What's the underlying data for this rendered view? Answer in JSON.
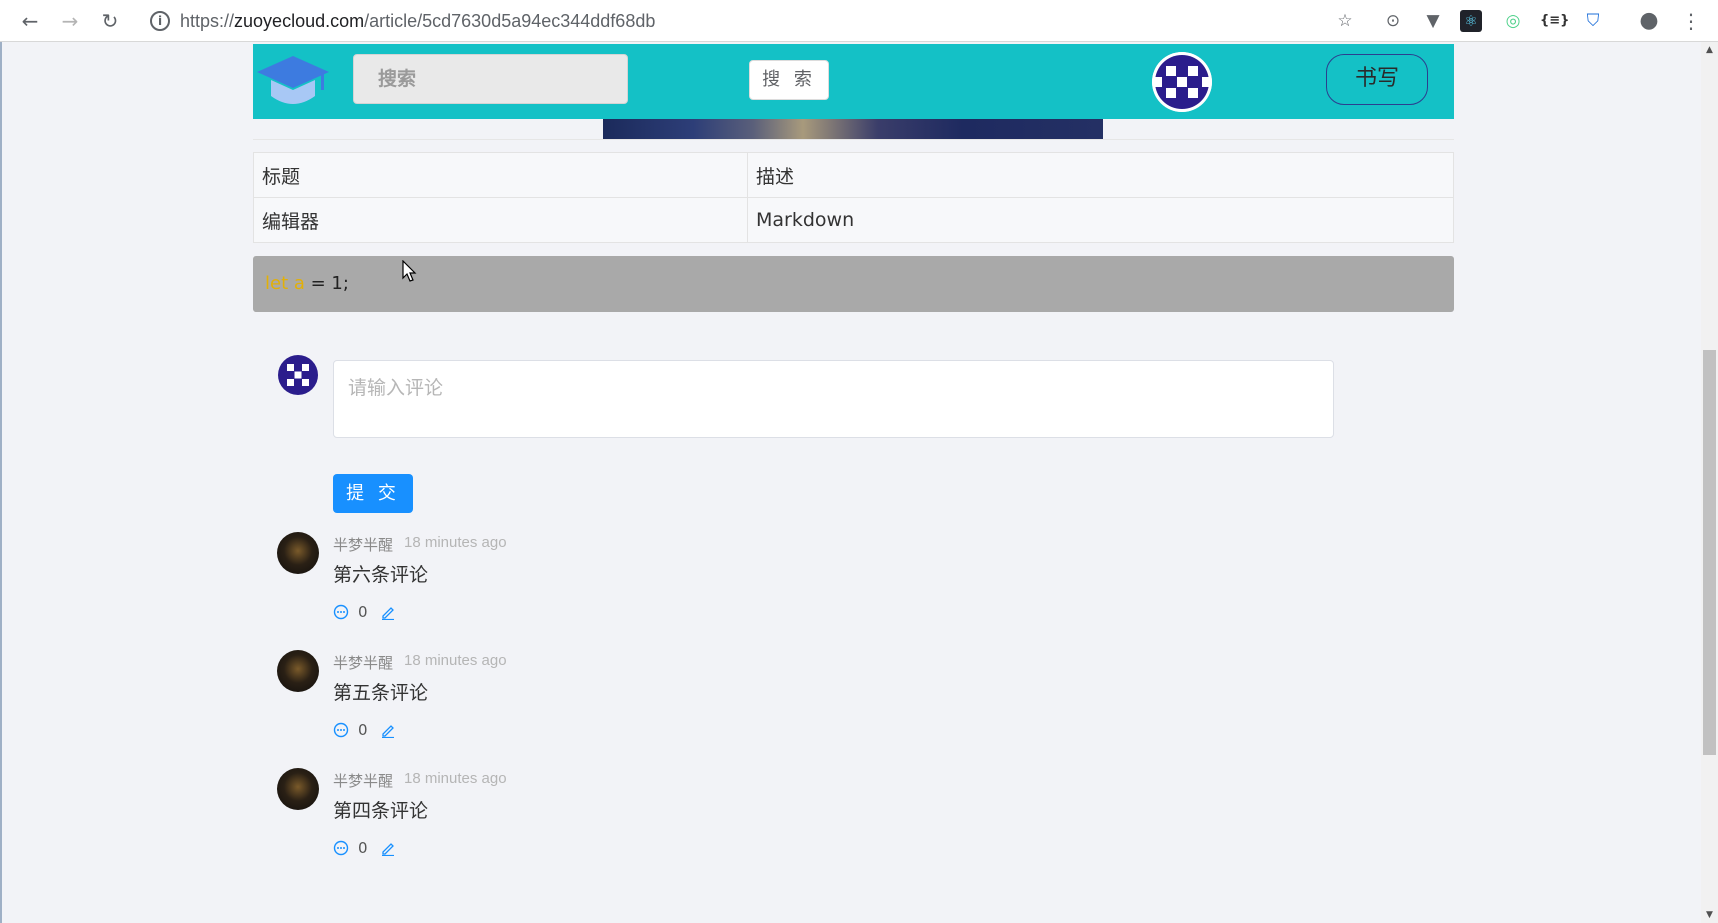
{
  "browser": {
    "url_scheme": "https://",
    "url_host": "zuoyecloud.com",
    "url_path": "/article/5cd7630d5a94ec344ddf68db"
  },
  "header": {
    "search_placeholder": "搜索",
    "search_button": "搜 索",
    "write_button": "书写"
  },
  "info_table": [
    {
      "key": "标题",
      "value": "描述"
    },
    {
      "key": "编辑器",
      "value": "Markdown"
    }
  ],
  "code": {
    "keyword": "let a",
    "rest": " = 1;"
  },
  "editor": {
    "placeholder": "请输入评论",
    "submit_label": "提 交"
  },
  "comments": [
    {
      "author": "半梦半醒",
      "time": "18 minutes ago",
      "text": "第六条评论",
      "reply_count": "0"
    },
    {
      "author": "半梦半醒",
      "time": "18 minutes ago",
      "text": "第五条评论",
      "reply_count": "0"
    },
    {
      "author": "半梦半醒",
      "time": "18 minutes ago",
      "text": "第四条评论",
      "reply_count": "0"
    }
  ],
  "colors": {
    "header_bg": "#14c1c6",
    "primary": "#1890ff",
    "code_keyword": "#e2b008"
  }
}
